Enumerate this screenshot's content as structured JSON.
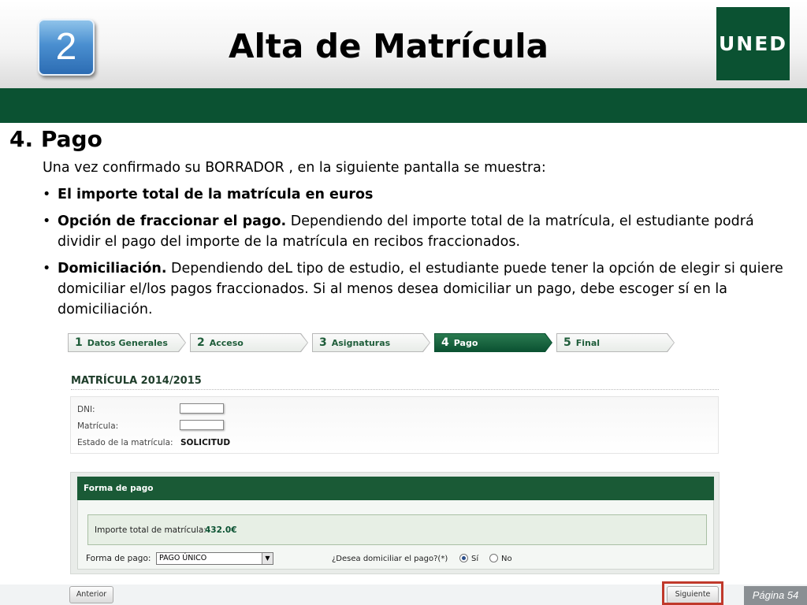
{
  "header": {
    "number": "2",
    "title": "Alta de Matrícula",
    "logo_text": "UNED"
  },
  "section": {
    "title": "4.  Pago",
    "intro": "Una vez confirmado su BORRADOR , en la siguiente pantalla se muestra:",
    "bullets": [
      {
        "bold": "El importe total de la matrícula en euros",
        "rest": ""
      },
      {
        "bold": "Opción de fraccionar el pago.",
        "rest": " Dependiendo del importe total de la matrícula, el estudiante podrá dividir el pago del importe de la matrícula en recibos fraccionados."
      },
      {
        "bold": "Domiciliación.",
        "rest": " Dependiendo deL tipo de estudio, el estudiante puede tener la opción de elegir si quiere domiciliar el/los pagos fraccionados. Si al menos desea domiciliar un pago, debe escoger sí en la domiciliación."
      }
    ]
  },
  "steps": [
    {
      "num": "1",
      "label": "Datos Generales",
      "active": false
    },
    {
      "num": "2",
      "label": "Acceso",
      "active": false
    },
    {
      "num": "3",
      "label": "Asignaturas",
      "active": false
    },
    {
      "num": "4",
      "label": "Pago",
      "active": true
    },
    {
      "num": "5",
      "label": "Final",
      "active": false
    }
  ],
  "form": {
    "title": "MATRÍCULA 2014/2015",
    "dni_label": "DNI:",
    "matricula_label": "Matrícula:",
    "estado_label": "Estado de la matrícula:",
    "estado_value": "SOLICITUD"
  },
  "payment": {
    "header": "Forma de pago",
    "amount_label": "Importe total de matrícula:",
    "amount_value": "432.0€",
    "forma_label": "Forma de pago:",
    "forma_selected": "PAGO ÚNICO",
    "domiciliar_label": "¿Desea domiciliar el pago?(*)",
    "option_si": "Sí",
    "option_no": "No",
    "selected_option": "si"
  },
  "nav": {
    "prev_label": "Anterior",
    "next_label": "Siguiente"
  },
  "footer": {
    "page_label": "Página 54"
  }
}
